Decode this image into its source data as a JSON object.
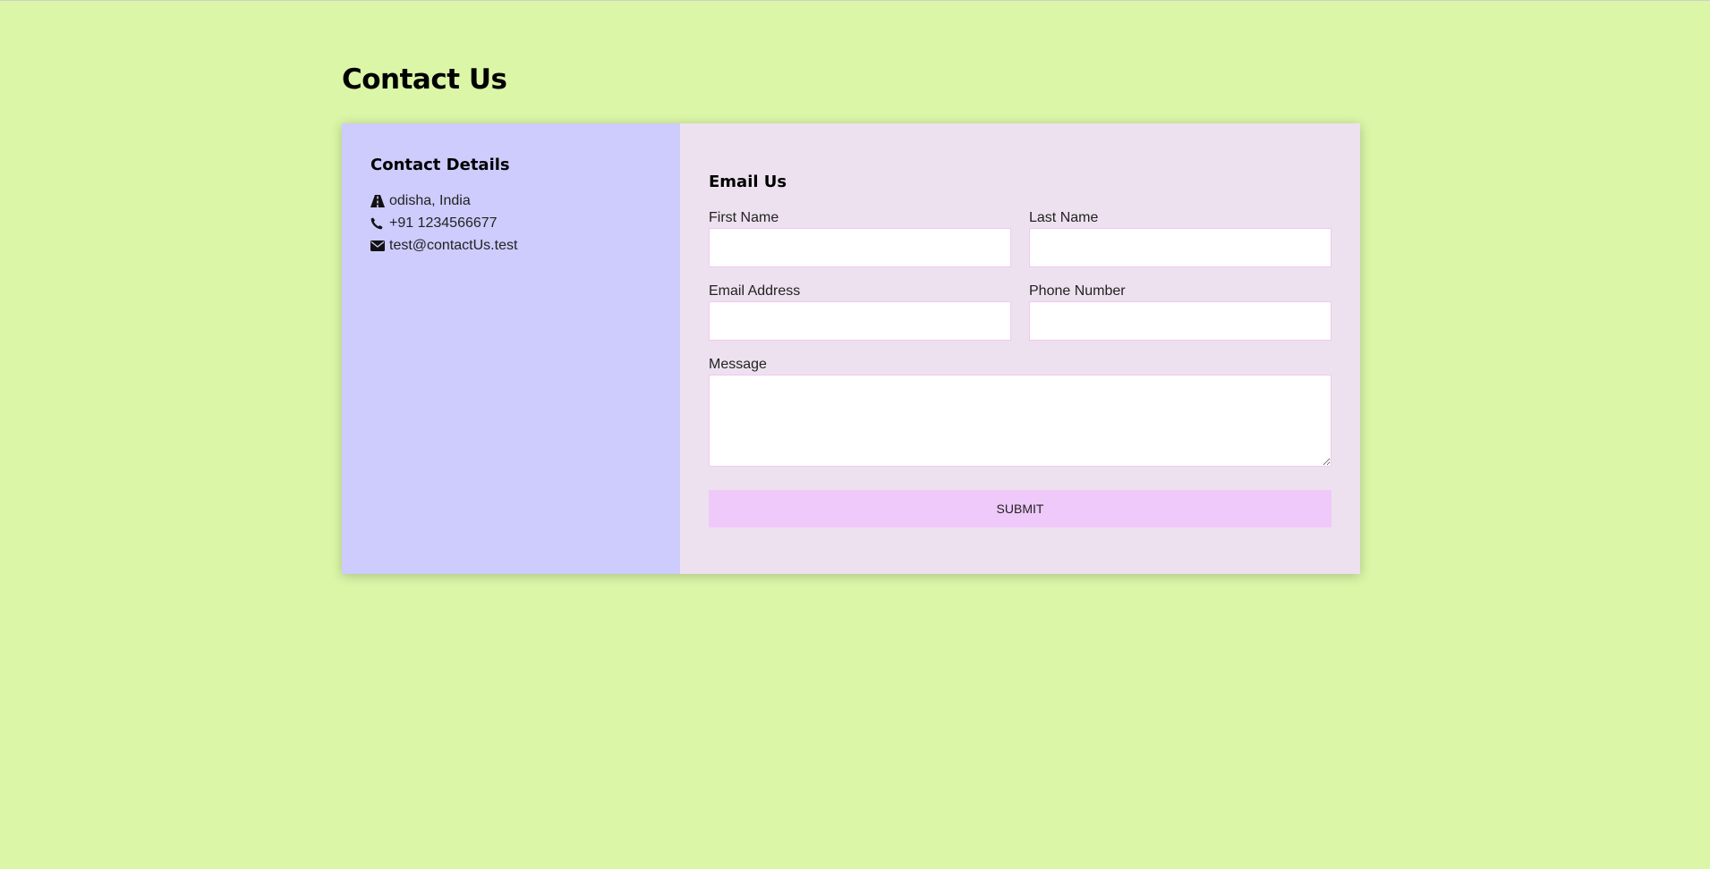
{
  "page": {
    "title": "Contact Us"
  },
  "contact_details": {
    "heading": "Contact Details",
    "items": [
      {
        "icon": "road-icon",
        "text": "odisha, India"
      },
      {
        "icon": "phone-icon",
        "text": "+91 1234566677"
      },
      {
        "icon": "envelope-icon",
        "text": "test@contactUs.test"
      }
    ]
  },
  "form": {
    "heading": "Email Us",
    "first_name": {
      "label": "First Name",
      "value": "",
      "placeholder": ""
    },
    "last_name": {
      "label": "Last Name",
      "value": "",
      "placeholder": ""
    },
    "email": {
      "label": "Email Address",
      "value": "",
      "placeholder": ""
    },
    "phone": {
      "label": "Phone Number",
      "value": "",
      "placeholder": ""
    },
    "message": {
      "label": "Message",
      "value": "",
      "placeholder": ""
    },
    "submit_label": "SUBMIT"
  },
  "colors": {
    "page_background": "#dbf6a7",
    "details_background": "#cdccfd",
    "form_background": "#ede1ef",
    "input_border": "#f3c6f1",
    "button_background": "#efc9f9"
  }
}
